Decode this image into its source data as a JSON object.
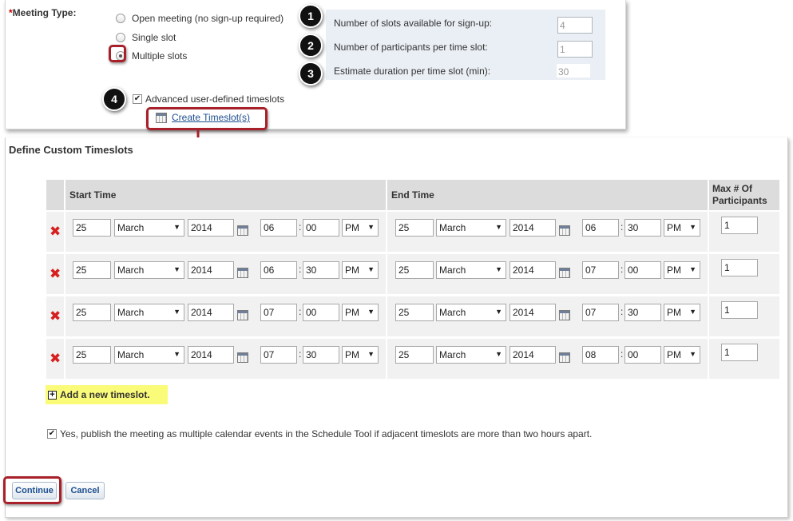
{
  "meeting_type": {
    "label": "Meeting Type:",
    "required_marker": "*",
    "options": [
      {
        "label": "Open meeting (no sign-up required)",
        "checked": false
      },
      {
        "label": "Single slot",
        "checked": false
      },
      {
        "label": "Multiple slots",
        "checked": true
      }
    ]
  },
  "slot_settings": {
    "slots_label": "Number of slots available for sign-up:",
    "slots_value": "4",
    "participants_label": "Number of participants per time slot:",
    "participants_value": "1",
    "duration_label": "Estimate duration per time slot (min):",
    "duration_value": "30"
  },
  "badges": [
    "1",
    "2",
    "3",
    "4"
  ],
  "advanced": {
    "label": "Advanced user-defined timeslots",
    "checked": true,
    "create_link": "Create Timeslot(s)"
  },
  "custom": {
    "title": "Define Custom Timeslots",
    "headers": {
      "start": "Start Time",
      "end": "End Time",
      "max": "Max # Of Participants"
    },
    "rows": [
      {
        "sd": "25",
        "sm": "March",
        "sy": "2014",
        "sh": "06",
        "smin": "00",
        "sap": "PM",
        "ed": "25",
        "em": "March",
        "ey": "2014",
        "eh": "06",
        "emin": "30",
        "eap": "PM",
        "max": "1"
      },
      {
        "sd": "25",
        "sm": "March",
        "sy": "2014",
        "sh": "06",
        "smin": "30",
        "sap": "PM",
        "ed": "25",
        "em": "March",
        "ey": "2014",
        "eh": "07",
        "emin": "00",
        "eap": "PM",
        "max": "1"
      },
      {
        "sd": "25",
        "sm": "March",
        "sy": "2014",
        "sh": "07",
        "smin": "00",
        "sap": "PM",
        "ed": "25",
        "em": "March",
        "ey": "2014",
        "eh": "07",
        "emin": "30",
        "eap": "PM",
        "max": "1"
      },
      {
        "sd": "25",
        "sm": "March",
        "sy": "2014",
        "sh": "07",
        "smin": "30",
        "sap": "PM",
        "ed": "25",
        "em": "March",
        "ey": "2014",
        "eh": "08",
        "emin": "00",
        "eap": "PM",
        "max": "1"
      }
    ],
    "add_label": "Add a new timeslot.",
    "publish_label": "Yes, publish the meeting as multiple calendar events in the Schedule Tool if adjacent timeslots are more than two hours apart.",
    "publish_checked": true
  },
  "buttons": {
    "continue": "Continue",
    "cancel": "Cancel"
  },
  "colors": {
    "highlight_red": "#a7202a",
    "link_blue": "#1c4f8f",
    "add_highlight": "#fbfb7a",
    "remove_red": "#d62020"
  }
}
